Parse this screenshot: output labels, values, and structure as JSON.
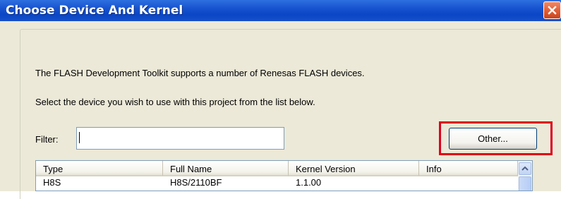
{
  "window": {
    "title": "Choose Device And Kernel"
  },
  "intro": {
    "line1": "The FLASH Development Toolkit supports a number of Renesas FLASH devices.",
    "line2": "Select the device you wish to use with this project from the list below."
  },
  "filter": {
    "label": "Filter:",
    "value": ""
  },
  "buttons": {
    "other": "Other..."
  },
  "device_list": {
    "columns": [
      "Type",
      "Full Name",
      "Kernel Version",
      "Info"
    ],
    "rows": [
      [
        "H8S",
        "H8S/2110BF",
        "1.1.00",
        ""
      ]
    ]
  },
  "colors": {
    "titlebar": "#0a46c6",
    "highlight": "#e0001a",
    "dialog_bg": "#ece9d8"
  }
}
